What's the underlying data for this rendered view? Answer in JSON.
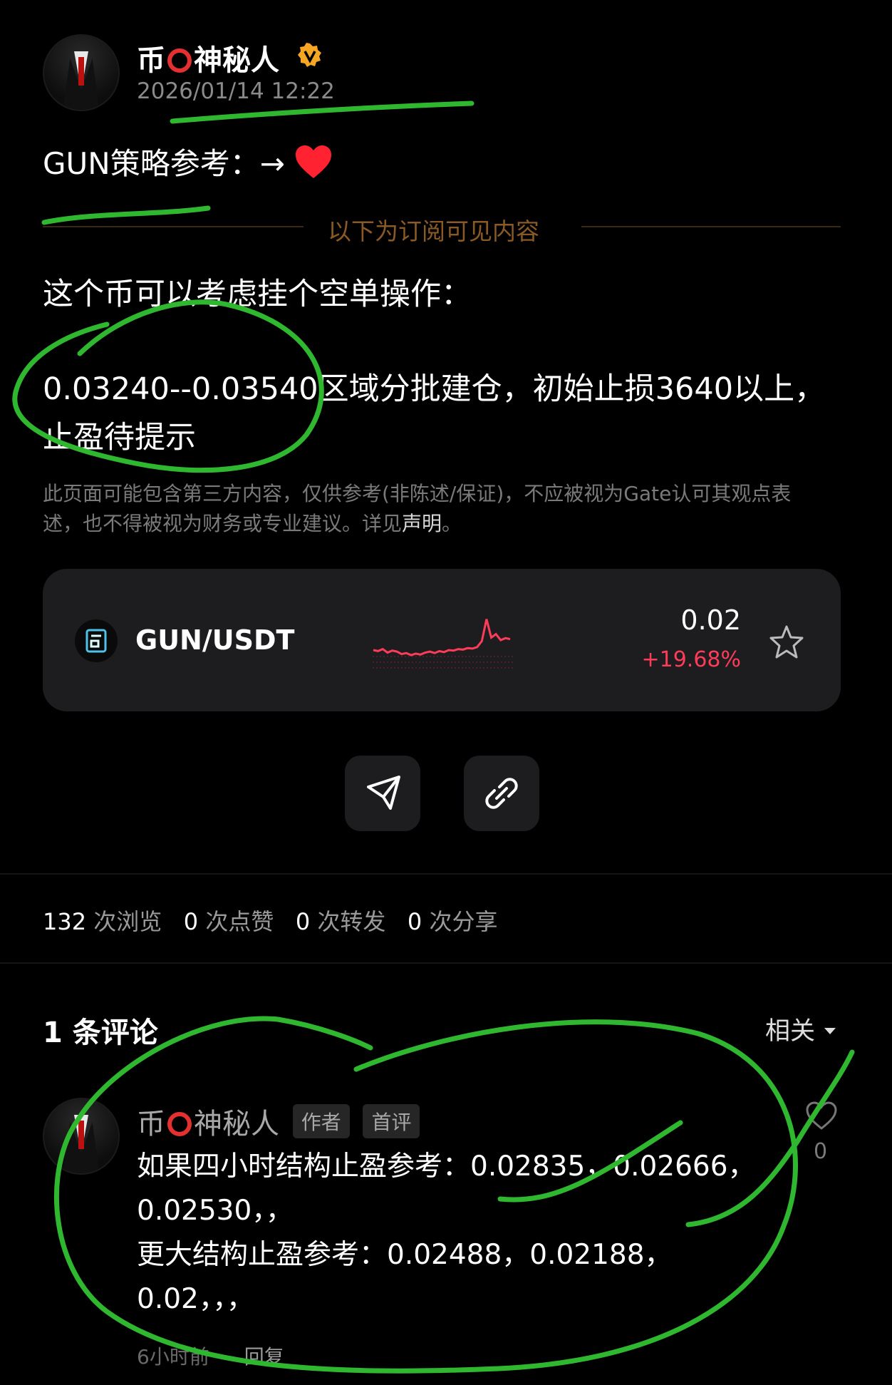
{
  "post": {
    "author_name_part1": "币",
    "author_name_part2": "神秘人",
    "timestamp": "2026/01/14 12:22",
    "title_text": "GUN策略参考：→",
    "subscriber_divider": "以下为订阅可见内容",
    "body_line1": "这个币可以考虑挂个空单操作：",
    "body_line2": "0.03240--0.03540区域分批建仓，初始止损3640以上，",
    "body_line3": "止盈待提示",
    "disclaimer_line1": "此页面可能包含第三方内容，仅供参考(非陈述/保证)，不应被视为Gate认可其观点表",
    "disclaimer_line2": "述，也不得被视为财务或专业建议。详见",
    "disclaimer_link": "声明",
    "disclaimer_end": "。"
  },
  "market_card": {
    "pair": "GUN/USDT",
    "price": "0.02",
    "change": "+19.68%",
    "sparkline": [
      0.3,
      0.28,
      0.32,
      0.25,
      0.29,
      0.27,
      0.22,
      0.24,
      0.2,
      0.23,
      0.21,
      0.25,
      0.27,
      0.24,
      0.28,
      0.26,
      0.3,
      0.29,
      0.32,
      0.31,
      0.34,
      0.33,
      0.36,
      0.48,
      0.92,
      0.55,
      0.62,
      0.5,
      0.54,
      0.52
    ],
    "colors": {
      "up": "#ff3b5a",
      "card_bg": "#1d1d1f"
    }
  },
  "stats": {
    "views_num": "132",
    "views_label": "次浏览",
    "likes_num": "0",
    "likes_label": "次点赞",
    "reposts_num": "0",
    "reposts_label": "次转发",
    "shares_num": "0",
    "shares_label": "次分享"
  },
  "comments": {
    "title": "1 条评论",
    "sort_label": "相关",
    "items": [
      {
        "name_part1": "币",
        "name_part2": "神秘人",
        "badge_author": "作者",
        "badge_first": "首评",
        "line1": "如果四小时结构止盈参考：0.02835，0.02666，",
        "line2": "0.02530，，",
        "line3": "更大结构止盈参考：0.02488，0.02188，",
        "line4": "0.02，，，",
        "time": "6小时前",
        "reply": "回复",
        "likes": "0"
      }
    ]
  },
  "icons": {
    "verified": "verified-badge-icon",
    "heart": "heart-emoji-icon",
    "coin": "gun-coin-icon",
    "star": "star-icon",
    "share": "send-icon",
    "link": "link-icon",
    "dropdown": "caret-down-icon",
    "like": "heart-outline-icon"
  },
  "annotation_color": "#2fb82f"
}
